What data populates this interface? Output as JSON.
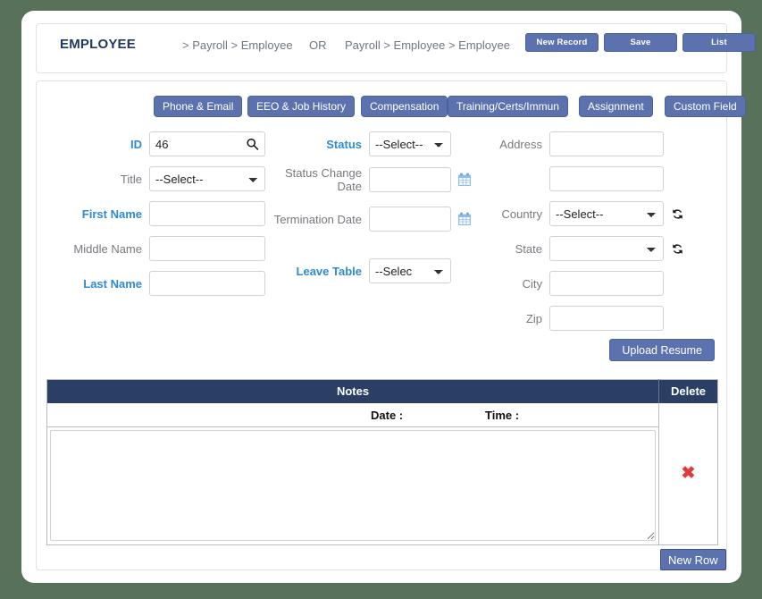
{
  "colors": {
    "page_background": "#57715a",
    "button_blue": "#5b72ae",
    "table_header_navy": "#2a3f63",
    "required_label": "#2e8bd4",
    "optional_label": "#76797e",
    "delete_red": "#e03b3b",
    "calendar_icon": "#7fb5e8"
  },
  "header": {
    "title": "EMPLOYEE",
    "breadcrumb_primary": "> Payroll > Employee",
    "breadcrumb_separator": "OR",
    "breadcrumb_secondary": "Payroll > Employee > Employee",
    "buttons": {
      "new_record": "New Record",
      "save": "Save",
      "list": "List"
    }
  },
  "tabs": [
    {
      "label": "Phone & Email"
    },
    {
      "label": "EEO & Job History"
    },
    {
      "label": "Compensation"
    },
    {
      "label": "Training/Certs/Immun"
    },
    {
      "label": "Assignment"
    },
    {
      "label": "Custom Field"
    }
  ],
  "form": {
    "column_left": {
      "id": {
        "label": "ID",
        "value": "46",
        "required": true,
        "icon": "search-icon"
      },
      "title": {
        "label": "Title",
        "value": "--Select--",
        "required": false
      },
      "first_name": {
        "label": "First Name",
        "value": "",
        "required": true
      },
      "middle_name": {
        "label": "Middle Name",
        "value": "",
        "required": false
      },
      "last_name": {
        "label": "Last Name",
        "value": "",
        "required": true
      }
    },
    "column_middle": {
      "status": {
        "label": "Status",
        "value": "--Select--",
        "required": true
      },
      "status_change_date": {
        "label": "Status Change\nDate",
        "value": "",
        "required": false,
        "icon": "calendar-icon"
      },
      "termination_date": {
        "label": "Termination Date",
        "value": "",
        "required": false,
        "icon": "calendar-icon"
      },
      "leave_table": {
        "label": "Leave Table",
        "value": "--Selec",
        "required": true
      }
    },
    "column_right": {
      "address": {
        "label": "Address",
        "value": "",
        "required": false
      },
      "address2": {
        "label": "",
        "value": "",
        "required": false
      },
      "country": {
        "label": "Country",
        "value": "--Select--",
        "required": false,
        "icon": "refresh-icon"
      },
      "state": {
        "label": "State",
        "value": "",
        "required": false,
        "icon": "refresh-icon"
      },
      "city": {
        "label": "City",
        "value": "",
        "required": false
      },
      "zip": {
        "label": "Zip",
        "value": "",
        "required": false
      }
    },
    "upload_resume_label": "Upload Resume"
  },
  "notes_table": {
    "headers": {
      "notes": "Notes",
      "delete": "Delete"
    },
    "row": {
      "date_label": "Date :",
      "time_label": "Time :",
      "note_value": "",
      "delete_icon": "✖"
    },
    "new_row_label": "New Row"
  }
}
